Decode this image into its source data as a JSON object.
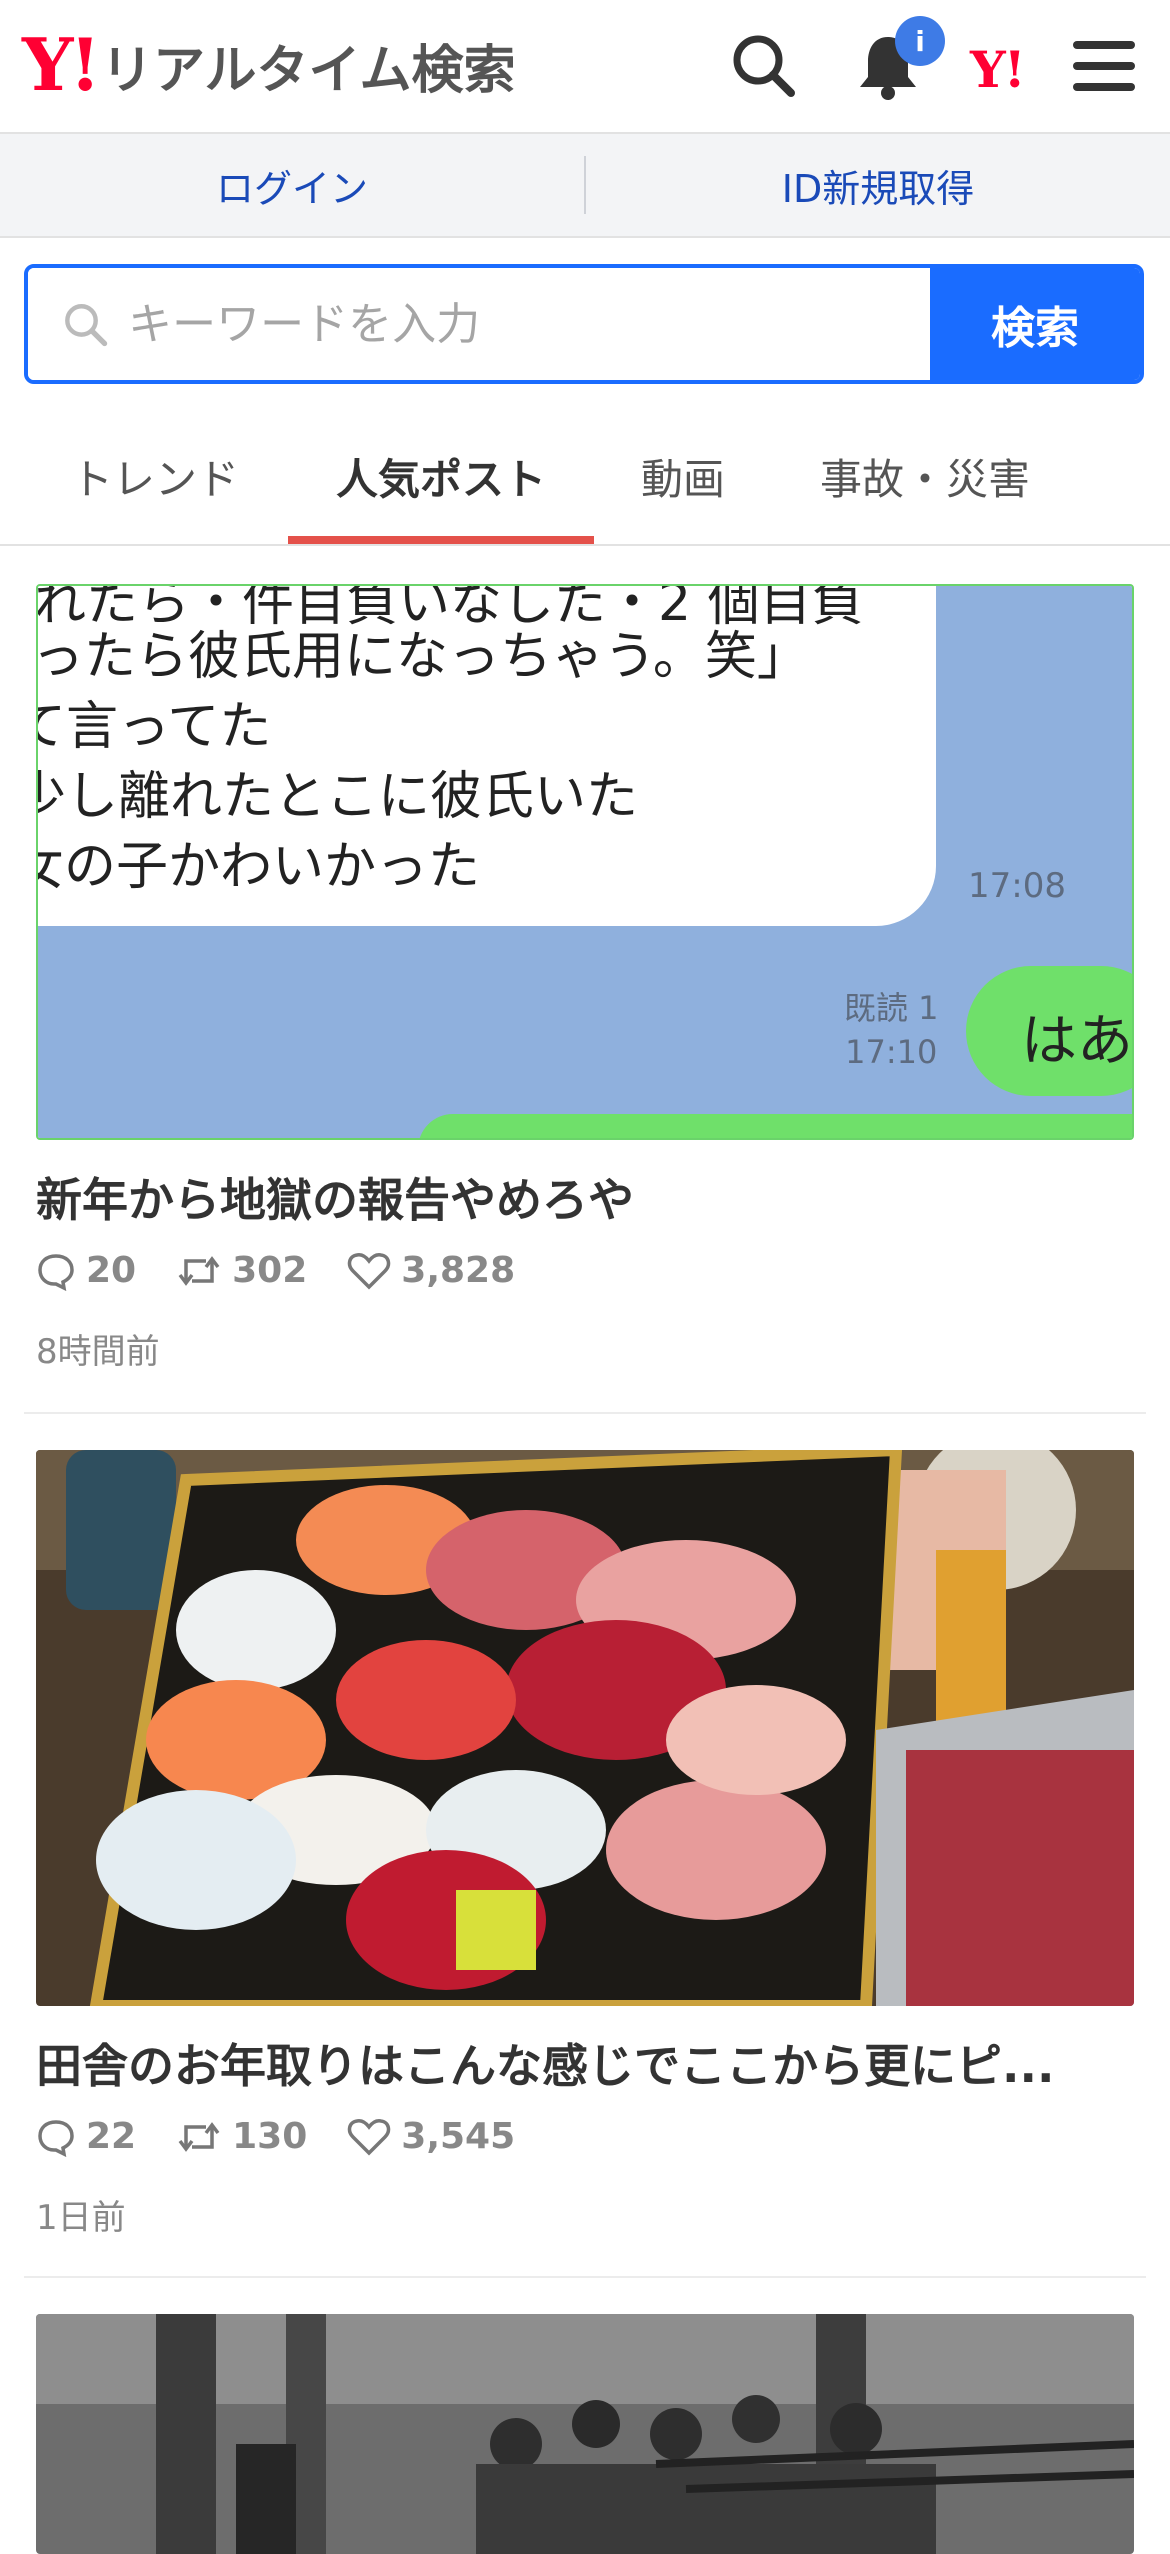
{
  "header": {
    "logo_mark": "Y!",
    "logo_text": "リアルタイム検索",
    "notification_badge": "i",
    "brand_small": "Y!"
  },
  "login_bar": {
    "login": "ログイン",
    "register": "ID新規取得"
  },
  "search": {
    "placeholder": "キーワードを入力",
    "button": "検索"
  },
  "tabs": [
    {
      "label": "トレンド",
      "active": false
    },
    {
      "label": "人気ポスト",
      "active": true
    },
    {
      "label": "動画",
      "active": false
    },
    {
      "label": "事故・災害",
      "active": false
    }
  ],
  "posts": [
    {
      "image_text": {
        "lines": [
          "れたら・件目負いなした・2 個目負",
          "ったら彼氏用になっちゃう。笑」",
          "て言ってた",
          "少し離れたとこに彼氏いた",
          "女の子かわいかった"
        ],
        "time": "17:08",
        "read_label": "既読 1",
        "read_time": "17:10",
        "reply": "はあ"
      },
      "title": "新年から地獄の報告やめろや",
      "replies": "20",
      "reposts": "302",
      "likes": "3,828",
      "time": "8時間前"
    },
    {
      "title": "田舎のお年取りはこんな感じでここから更にピ...",
      "replies": "22",
      "reposts": "130",
      "likes": "3,545",
      "time": "1日前"
    }
  ],
  "colors": {
    "brand_red": "#ff0033",
    "link_blue": "#1a4ab8",
    "search_blue": "#1a6cff",
    "tab_underline": "#e4514a",
    "badge_blue": "#3e7be6"
  }
}
